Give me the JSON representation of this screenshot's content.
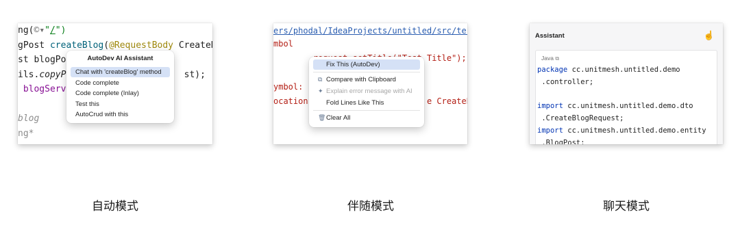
{
  "auto": {
    "code_lines": [
      {
        "parts": [
          {
            "t": "ng(",
            "c": "#1f1f1f"
          },
          {
            "t": "©",
            "c": "#6b6b6b"
          },
          {
            "t": "▾",
            "c": "#6b6b6b"
          },
          {
            "t": "\"",
            "c": "#067d17"
          },
          {
            "t": "/",
            "c": "#067d17",
            "u": true
          },
          {
            "t": "\")",
            "c": "#067d17"
          }
        ]
      },
      {
        "parts": [
          {
            "t": "gPost ",
            "c": "#1f1f1f"
          },
          {
            "t": "createBlog",
            "c": "#00627a"
          },
          {
            "t": "(",
            "c": "#1f1f1f"
          },
          {
            "t": "@RequestBody",
            "c": "#9e880d"
          },
          {
            "t": " CreateBlogRe",
            "c": "#1f1f1f"
          }
        ]
      },
      {
        "parts": [
          {
            "t": "st blogPost",
            "c": "#1f1f1f"
          }
        ]
      },
      {
        "parts": [
          {
            "t": "ils.",
            "c": "#1f1f1f"
          },
          {
            "t": "copyPro",
            "c": "#1f1f1f",
            "i": true
          },
          {
            "t": "                    st);",
            "c": "#1f1f1f"
          }
        ]
      },
      {
        "parts": [
          {
            "t": " blogServic",
            "c": "#871094"
          }
        ]
      },
      {
        "parts": [
          {
            "t": " ",
            "c": "#1f1f1f"
          }
        ]
      },
      {
        "parts": [
          {
            "t": "blog",
            "c": "#8c8c8c",
            "i": true
          }
        ]
      },
      {
        "parts": [
          {
            "t": "ng",
            "c": "#8c8c8c"
          },
          {
            "t": "*",
            "c": "#8c8c8c"
          }
        ]
      }
    ],
    "popup_title": "AutoDev AI Assistant",
    "menu": [
      {
        "label": "Chat with 'createBlog' method",
        "selected": true
      },
      {
        "label": "Code complete",
        "selected": false
      },
      {
        "label": "Code complete (Inlay)",
        "selected": false
      },
      {
        "label": "Test this",
        "selected": false
      },
      {
        "label": "AutoCrud with this",
        "selected": false
      }
    ],
    "caption": "自动模式"
  },
  "companion": {
    "path_link": "ers/phodal/IdeaProjects/untitled/src/test/",
    "code_lines": [
      {
        "parts": [
          {
            "t": "mbol",
            "c": "#b31e14"
          }
        ]
      },
      {
        "parts": [
          {
            "t": "        request.setTitle(\"Test Title\");",
            "c": "#b31e14"
          }
        ]
      },
      {
        "parts": [
          {
            "t": " ",
            "c": "#1f1f1f"
          }
        ]
      },
      {
        "parts": [
          {
            "t": "ymbol:",
            "c": "#b31e14"
          }
        ]
      },
      {
        "parts": [
          {
            "t": "ocation:                       e CreateBl",
            "c": "#b31e14"
          }
        ]
      }
    ],
    "menu": [
      {
        "label": "Fix This (AutoDev)",
        "icon": "",
        "icon_name": "",
        "selected": true,
        "disabled": false,
        "divider_after": true
      },
      {
        "label": "Compare with Clipboard",
        "icon": "⧉",
        "icon_name": "compare-clipboard-icon",
        "selected": false,
        "disabled": false,
        "divider_after": false
      },
      {
        "label": "Explain error message with AI",
        "icon": "✦",
        "icon_name": "sparkle-icon",
        "selected": false,
        "disabled": true,
        "divider_after": false
      },
      {
        "label": "Fold Lines Like This",
        "icon": "",
        "icon_name": "",
        "selected": false,
        "disabled": false,
        "divider_after": true
      },
      {
        "label": "Clear All",
        "icon": "🗑",
        "icon_name": "trash-icon",
        "selected": false,
        "disabled": false,
        "divider_after": false
      }
    ],
    "caption": "伴随模式"
  },
  "chat": {
    "title": "Assistant",
    "hand_icon": "pointer-hand-icon",
    "lang_label": "Java",
    "copy_icon": "copy-icon",
    "code_lines": [
      {
        "parts": [
          {
            "t": "package",
            "c": "#0033b3"
          },
          {
            "t": " cc.unitmesh.untitled.demo",
            "c": "#1f1f1f"
          }
        ]
      },
      {
        "parts": [
          {
            "t": " .controller;",
            "c": "#1f1f1f"
          }
        ]
      },
      {
        "parts": [
          {
            "t": " ",
            "c": "#1f1f1f"
          }
        ]
      },
      {
        "parts": [
          {
            "t": "import",
            "c": "#0033b3"
          },
          {
            "t": " cc.unitmesh.untitled.demo.dto",
            "c": "#1f1f1f"
          }
        ]
      },
      {
        "parts": [
          {
            "t": " .CreateBlogRequest;",
            "c": "#1f1f1f"
          }
        ]
      },
      {
        "parts": [
          {
            "t": "import",
            "c": "#0033b3"
          },
          {
            "t": " cc.unitmesh.untitled.demo.entity",
            "c": "#1f1f1f"
          }
        ]
      },
      {
        "parts": [
          {
            "t": " .BlogPost;",
            "c": "#1f1f1f"
          }
        ]
      }
    ],
    "caption": "聊天模式"
  }
}
